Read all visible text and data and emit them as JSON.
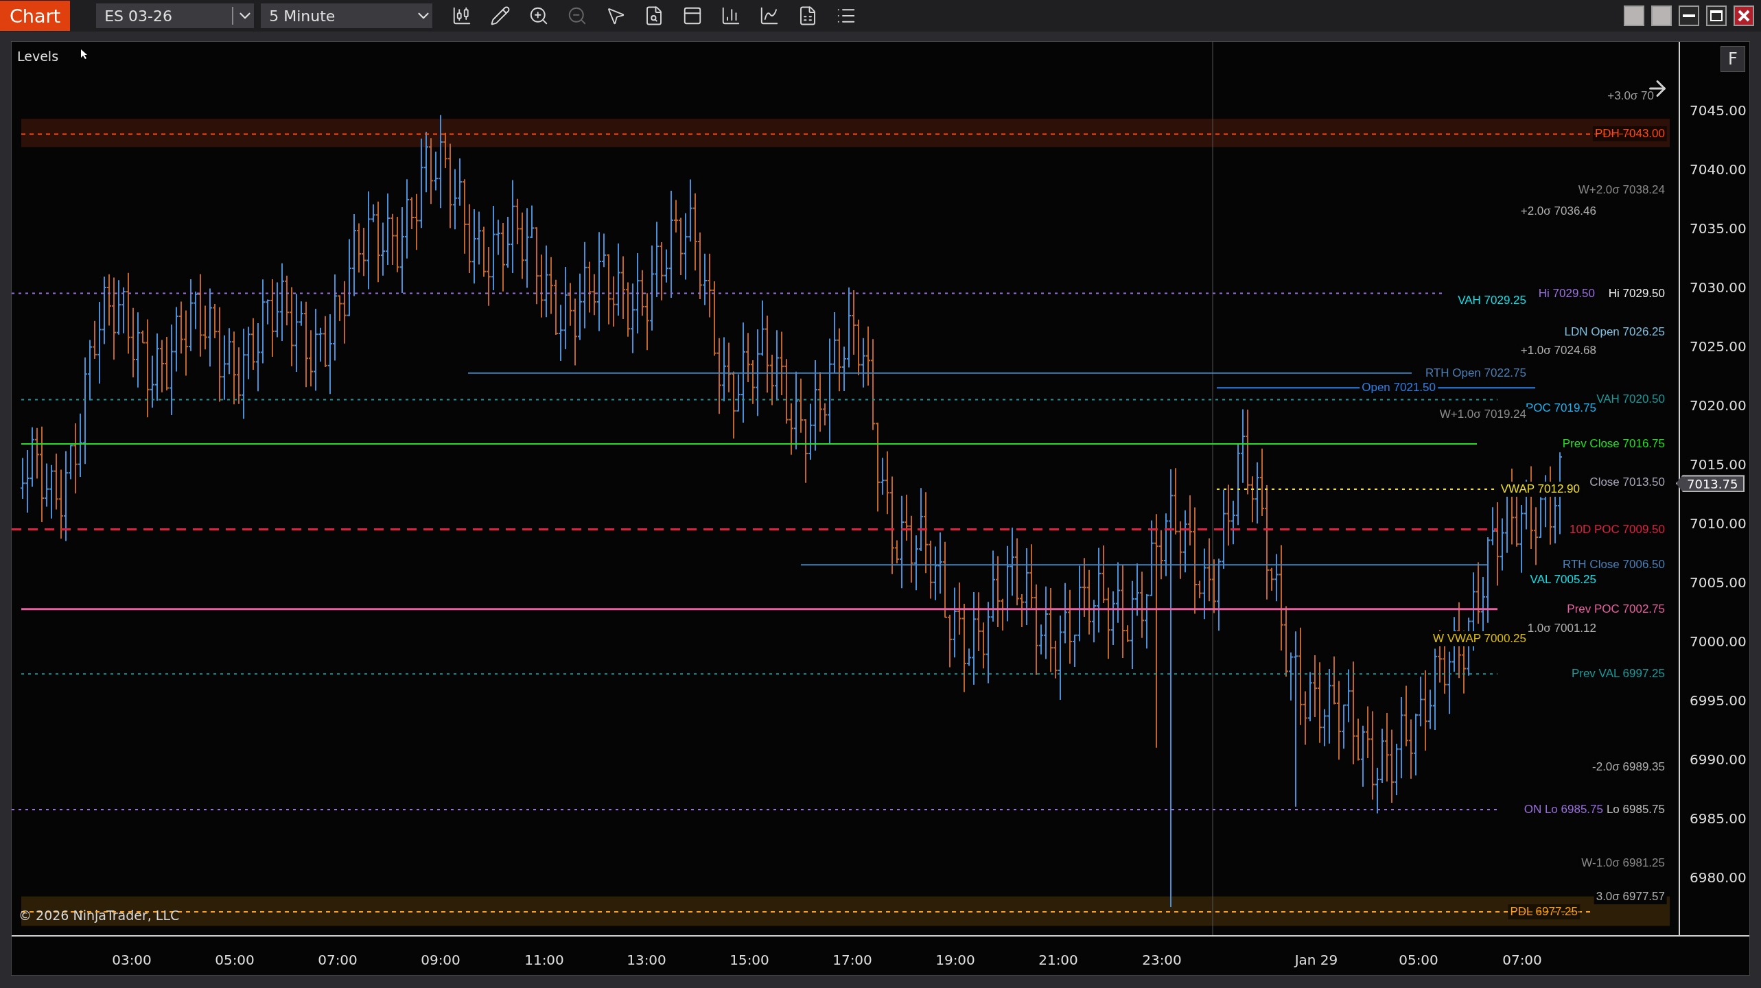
{
  "toolbar": {
    "tab": "Chart",
    "instrument": "ES 03-26",
    "interval": "5 Minute"
  },
  "chart": {
    "title": "Levels",
    "copyright": "© 2026 NinjaTrader, LLC",
    "f_button": "F",
    "last_price": "7013.75",
    "price_axis": [
      "7045.00",
      "7040.00",
      "7035.00",
      "7030.00",
      "7025.00",
      "7020.00",
      "7015.00",
      "7010.00",
      "7005.00",
      "7000.00",
      "6995.00",
      "6990.00",
      "6985.00",
      "6980.00"
    ],
    "time_axis": [
      "03:00",
      "05:00",
      "07:00",
      "09:00",
      "11:00",
      "13:00",
      "15:00",
      "17:00",
      "19:00",
      "21:00",
      "23:00",
      "Jan 29",
      "05:00",
      "07:00"
    ],
    "levels": [
      {
        "label": "+3.0σ 70",
        "color": "#a0a0a0",
        "kind": "none"
      },
      {
        "label": "PDH 7043.00",
        "color": "#ff4a10",
        "kind": "band"
      },
      {
        "label": "W+2.0σ 7038.24",
        "color": "#8a8a8a",
        "kind": "none"
      },
      {
        "label": "+2.0σ 7036.46",
        "color": "#b0b0b0",
        "kind": "none"
      },
      {
        "label": "VAH 7029.25",
        "color": "#10e0e8",
        "kind": "none"
      },
      {
        "label": "Hi 7029.50",
        "color": "#9a70e0",
        "kind": "dotted"
      },
      {
        "label": "Hi 7029.50",
        "color": "#f0f0f0",
        "kind": "none"
      },
      {
        "label": "LDN Open 7026.25",
        "color": "#80c0e0",
        "kind": "none"
      },
      {
        "label": "+1.0σ 7024.68",
        "color": "#b0b0b0",
        "kind": "none"
      },
      {
        "label": "RTH Open 7022.75",
        "color": "#4a80b8",
        "kind": "solid"
      },
      {
        "label": "Open 7021.50",
        "color": "#2f80e8",
        "kind": "solid"
      },
      {
        "label": "VAH 7020.50",
        "color": "#1a9a9a",
        "kind": "dotted"
      },
      {
        "label": "POC 7019.75",
        "color": "#20b4f4",
        "kind": "none"
      },
      {
        "label": "W+1.0σ 7019.24",
        "color": "#8a8a8a",
        "kind": "none"
      },
      {
        "label": "Prev Close 7016.75",
        "color": "#20e020",
        "kind": "solid"
      },
      {
        "label": "Close 7013.50",
        "color": "#a8a8b8",
        "kind": "none"
      },
      {
        "label": "VWAP 7012.90",
        "color": "#f0e020",
        "kind": "dotted"
      },
      {
        "label": "10D POC 7009.50",
        "color": "#e02040",
        "kind": "dashed"
      },
      {
        "label": "RTH Close 7006.50",
        "color": "#4a80b8",
        "kind": "solid"
      },
      {
        "label": "VAL 7005.25",
        "color": "#10e0e8",
        "kind": "none"
      },
      {
        "label": "Prev POC 7002.75",
        "color": "#e860a0",
        "kind": "solid"
      },
      {
        "label": "1.0σ 7001.12",
        "color": "#b0b0b0",
        "kind": "none"
      },
      {
        "label": "W VWAP 7000.25",
        "color": "#e0c000",
        "kind": "none"
      },
      {
        "label": "Prev VAL 6997.25",
        "color": "#1a9a9a",
        "kind": "dotted"
      },
      {
        "label": "-2.0σ 6989.35",
        "color": "#b0b0b0",
        "kind": "none"
      },
      {
        "label": "ON Lo 6985.75",
        "color": "#9a70e0",
        "kind": "dotted"
      },
      {
        "label": "Lo 6985.75",
        "color": "#c0c0c0",
        "kind": "none"
      },
      {
        "label": "W-1.0σ 6981.25",
        "color": "#8a8a8a",
        "kind": "none"
      },
      {
        "label": "3.0σ 6977.57",
        "color": "#b0b0b0",
        "kind": "none"
      },
      {
        "label": "PDL 6977.25",
        "color": "#ffa010",
        "kind": "band"
      }
    ]
  }
}
